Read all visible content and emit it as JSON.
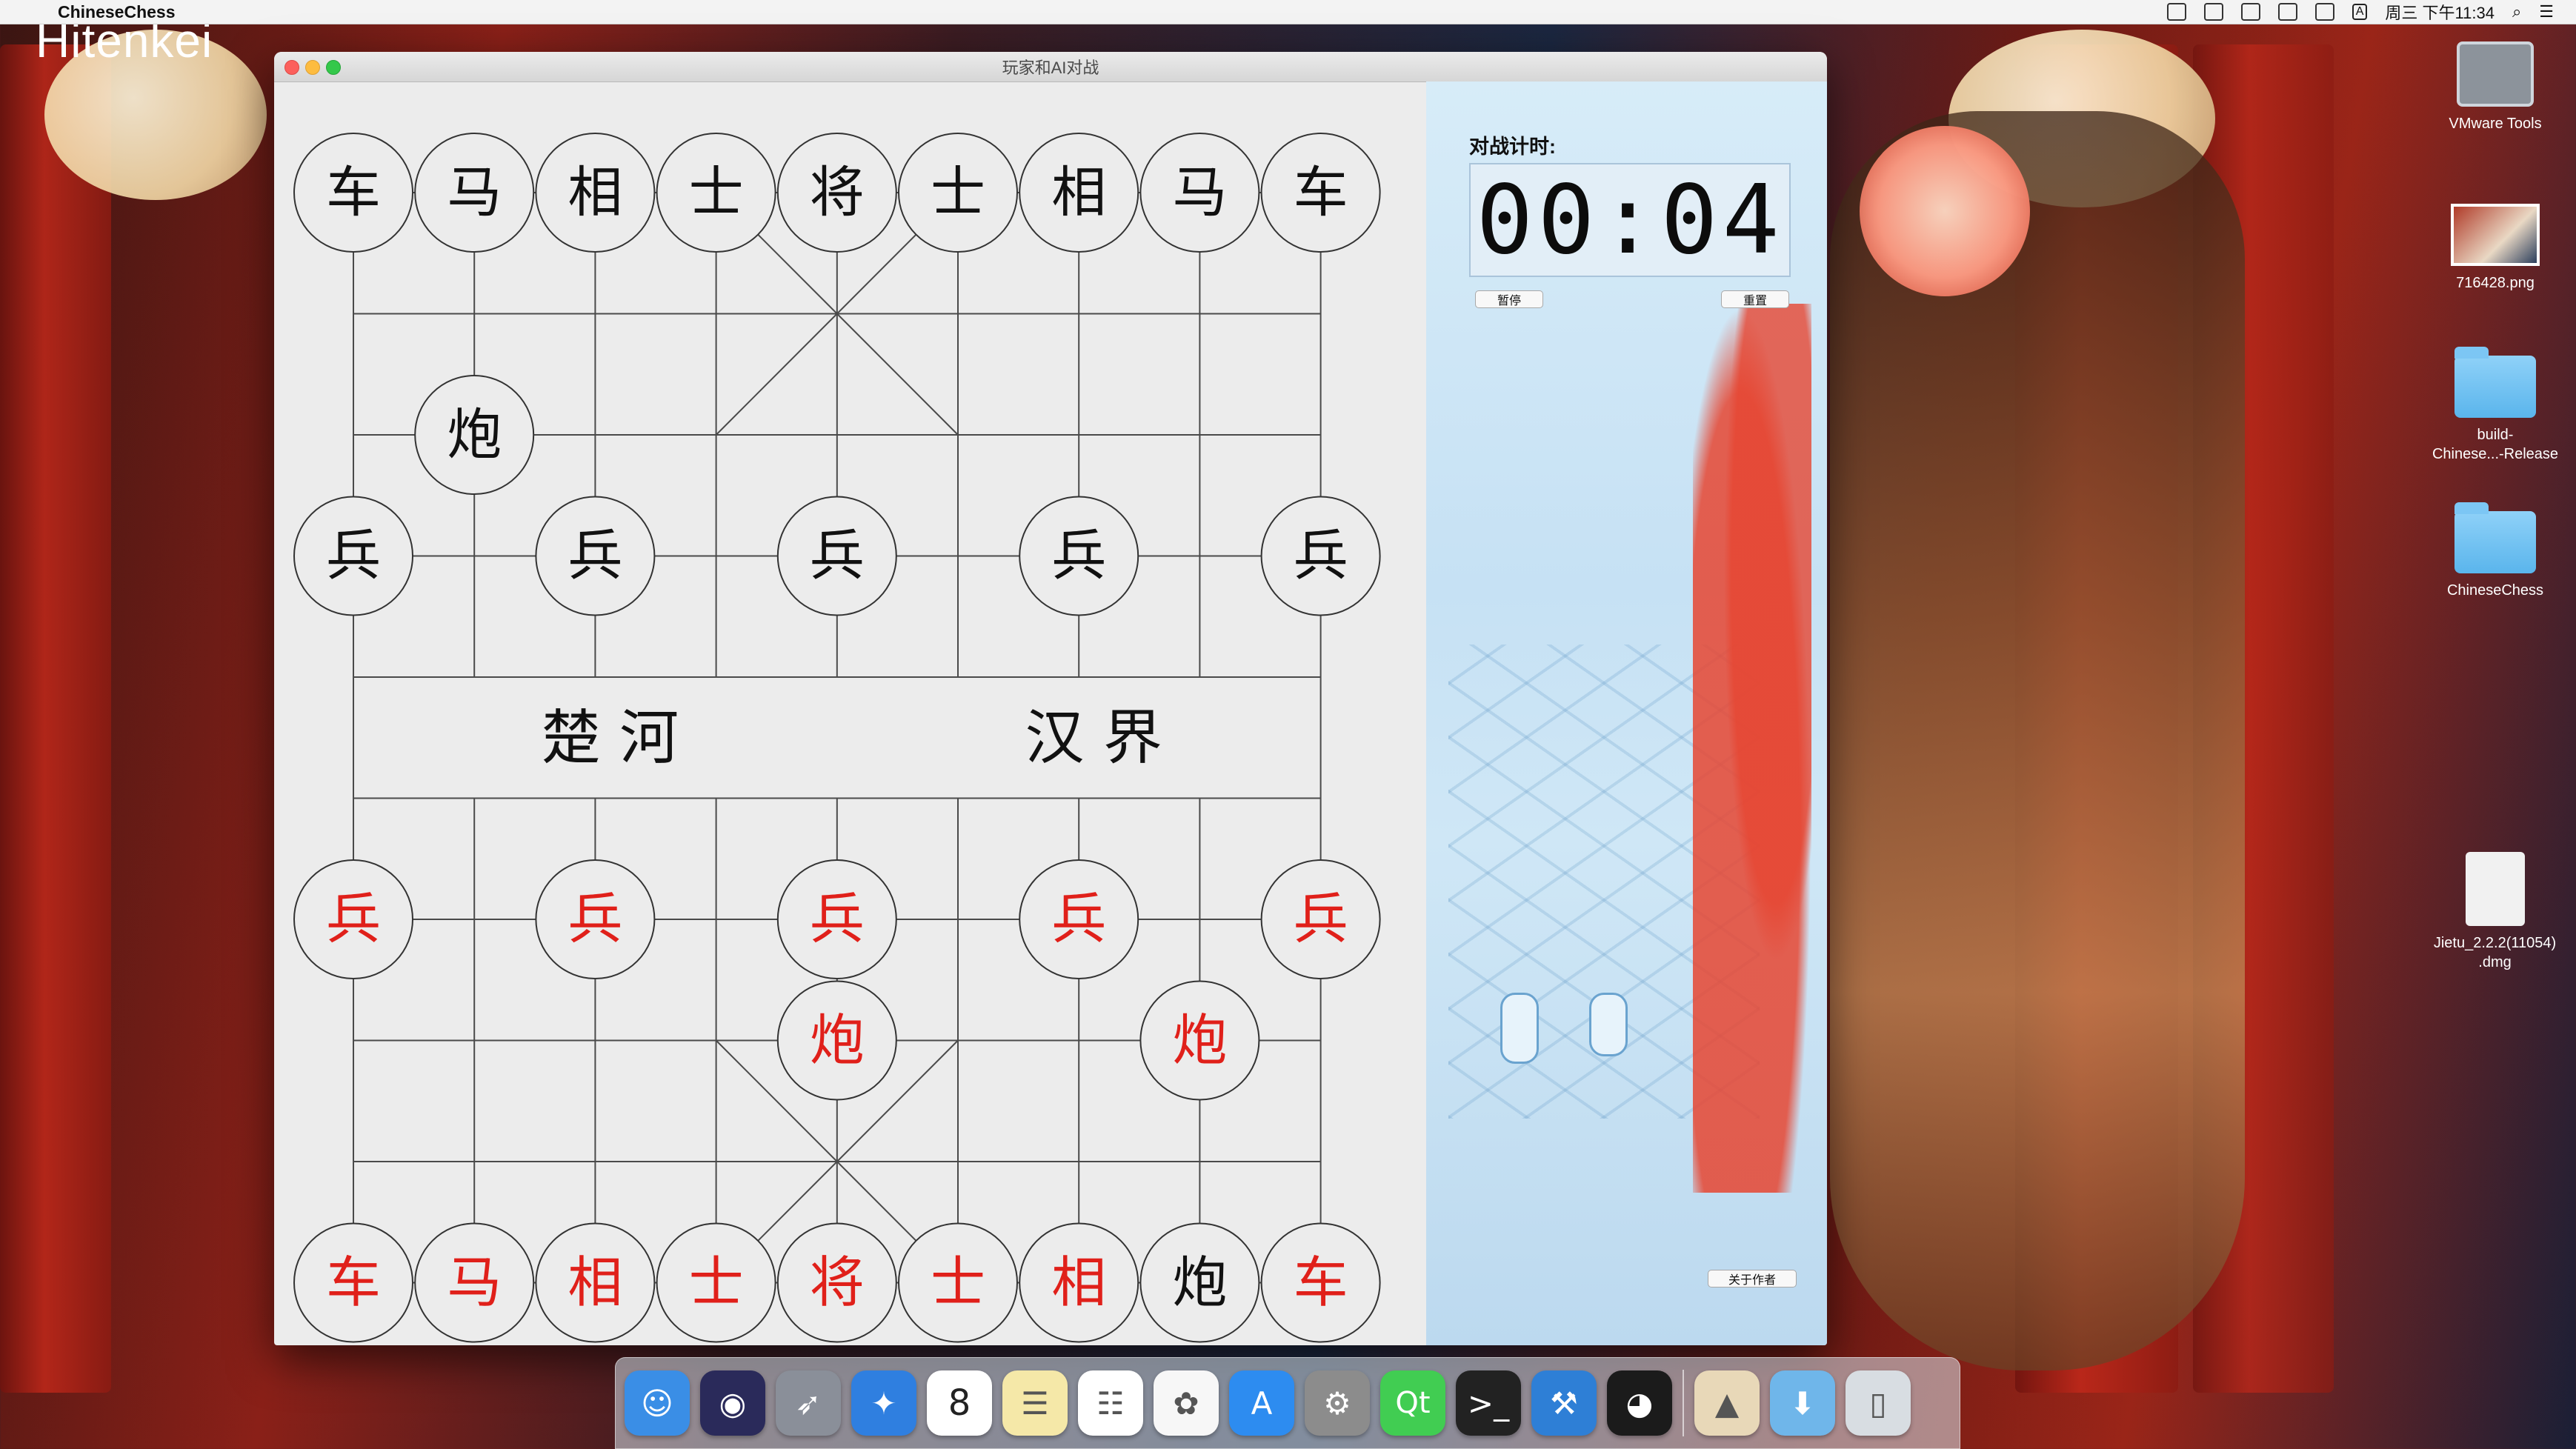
{
  "menubar": {
    "apple_glyph": "",
    "app_name": "ChineseChess",
    "clock": "周三 下午11:34",
    "input_method": "A"
  },
  "desktop": {
    "wallpaper_text": "Hitenkei",
    "icons": [
      {
        "label": "VMware Tools",
        "kind": "vmware"
      },
      {
        "label": "716428.png",
        "kind": "png"
      },
      {
        "label": "build-\nChinese...-Release",
        "kind": "folder"
      },
      {
        "label": "ChineseChess",
        "kind": "folder"
      },
      {
        "label": "Jietu_2.2.2(11054)\n.dmg",
        "kind": "dmg"
      }
    ]
  },
  "window": {
    "title": "玩家和AI对战"
  },
  "board": {
    "river_left": "楚 河",
    "river_right": "汉 界",
    "colors": {
      "black": "#111111",
      "red": "#e0201a",
      "line": "#4a4a4a",
      "piece_bg": "#ececec"
    },
    "pieces": [
      {
        "name": "车",
        "side": "black",
        "col": 0,
        "row": 0
      },
      {
        "name": "马",
        "side": "black",
        "col": 1,
        "row": 0
      },
      {
        "name": "相",
        "side": "black",
        "col": 2,
        "row": 0
      },
      {
        "name": "士",
        "side": "black",
        "col": 3,
        "row": 0
      },
      {
        "name": "将",
        "side": "black",
        "col": 4,
        "row": 0
      },
      {
        "name": "士",
        "side": "black",
        "col": 5,
        "row": 0
      },
      {
        "name": "相",
        "side": "black",
        "col": 6,
        "row": 0
      },
      {
        "name": "马",
        "side": "black",
        "col": 7,
        "row": 0
      },
      {
        "name": "车",
        "side": "black",
        "col": 8,
        "row": 0
      },
      {
        "name": "炮",
        "side": "black",
        "col": 1,
        "row": 2
      },
      {
        "name": "兵",
        "side": "black",
        "col": 0,
        "row": 3
      },
      {
        "name": "兵",
        "side": "black",
        "col": 2,
        "row": 3
      },
      {
        "name": "兵",
        "side": "black",
        "col": 4,
        "row": 3
      },
      {
        "name": "兵",
        "side": "black",
        "col": 6,
        "row": 3
      },
      {
        "name": "兵",
        "side": "black",
        "col": 8,
        "row": 3
      },
      {
        "name": "兵",
        "side": "red",
        "col": 0,
        "row": 6
      },
      {
        "name": "兵",
        "side": "red",
        "col": 2,
        "row": 6
      },
      {
        "name": "兵",
        "side": "red",
        "col": 4,
        "row": 6
      },
      {
        "name": "兵",
        "side": "red",
        "col": 6,
        "row": 6
      },
      {
        "name": "兵",
        "side": "red",
        "col": 8,
        "row": 6
      },
      {
        "name": "炮",
        "side": "red",
        "col": 4,
        "row": 7
      },
      {
        "name": "炮",
        "side": "red",
        "col": 7,
        "row": 7
      },
      {
        "name": "车",
        "side": "red",
        "col": 0,
        "row": 9
      },
      {
        "name": "马",
        "side": "red",
        "col": 1,
        "row": 9
      },
      {
        "name": "相",
        "side": "red",
        "col": 2,
        "row": 9
      },
      {
        "name": "士",
        "side": "red",
        "col": 3,
        "row": 9
      },
      {
        "name": "将",
        "side": "red",
        "col": 4,
        "row": 9
      },
      {
        "name": "士",
        "side": "red",
        "col": 5,
        "row": 9
      },
      {
        "name": "相",
        "side": "red",
        "col": 6,
        "row": 9
      },
      {
        "name": "炮",
        "side": "black",
        "col": 7,
        "row": 9
      },
      {
        "name": "车",
        "side": "red",
        "col": 8,
        "row": 9
      }
    ]
  },
  "panel": {
    "timer_label": "对战计时:",
    "timer_value": "00:04",
    "pause_label": "暂停",
    "reset_label": "重置",
    "about_label": "关于作者"
  },
  "dock": {
    "calendar_day": "8",
    "qt_label": "Qt",
    "apps": [
      {
        "name": "finder",
        "icon": "finder-icon",
        "color": "#3a8ee6"
      },
      {
        "name": "siri",
        "icon": "siri-icon",
        "color": "#2a2a5a"
      },
      {
        "name": "launchpad",
        "icon": "rocket-icon",
        "color": "#8a8f99"
      },
      {
        "name": "safari",
        "icon": "compass-icon",
        "color": "#2f7fe0"
      },
      {
        "name": "calendar",
        "icon": "calendar-icon",
        "color": "#ffffff"
      },
      {
        "name": "notes",
        "icon": "notes-icon",
        "color": "#f5e8a8"
      },
      {
        "name": "reminders",
        "icon": "list-icon",
        "color": "#ffffff"
      },
      {
        "name": "photos",
        "icon": "photos-icon",
        "color": "#f7f7f7"
      },
      {
        "name": "app-store",
        "icon": "app-store-icon",
        "color": "#2d8cf0"
      },
      {
        "name": "system-preferences",
        "icon": "gear-icon",
        "color": "#8c8c8c"
      },
      {
        "name": "qt-creator",
        "icon": "qt-icon",
        "color": "#41cd52"
      },
      {
        "name": "terminal",
        "icon": "terminal-icon",
        "color": "#222222"
      },
      {
        "name": "xcode",
        "icon": "hammer-icon",
        "color": "#2e7fd6"
      },
      {
        "name": "qq",
        "icon": "penguin-icon",
        "color": "#1b1b1b"
      },
      {
        "name": "preview",
        "icon": "preview-icon",
        "color": "#e8d8b8"
      },
      {
        "name": "downloads",
        "icon": "download-folder-icon",
        "color": "#6fb6ea"
      },
      {
        "name": "trash",
        "icon": "trash-icon",
        "color": "#d8dde2"
      }
    ]
  }
}
